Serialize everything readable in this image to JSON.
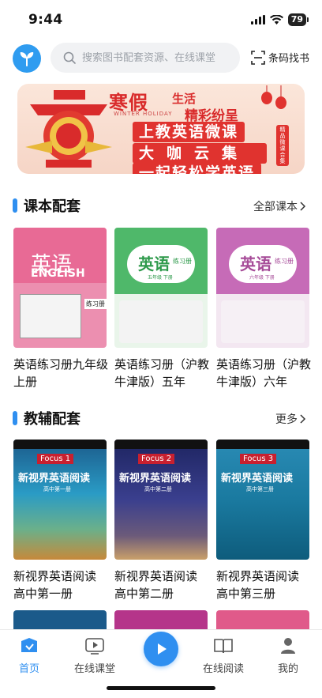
{
  "status": {
    "time": "9:44",
    "battery": "79"
  },
  "header": {
    "search_placeholder": "搜索图书配套资源、在线课堂",
    "scan_label": "条码找书"
  },
  "banner": {
    "title_main": "寒假",
    "title_small_1": "生活",
    "title_small_2": "精彩纷呈",
    "subtitle": "WINTER HOLIDAY",
    "line_1": "上教英语微课",
    "line_2": "大咖云集",
    "line_3": "一起轻松学英语",
    "tag": "精品微课合集"
  },
  "textbook_section": {
    "title": "课本配套",
    "more": "全部课本",
    "books": [
      {
        "title": "英语练习册九年级上册",
        "cover_main": "英语",
        "cover_sub": "ENGLISH",
        "cover_badge": "练习册",
        "color": "#e55b86"
      },
      {
        "title": "英语练习册（沪教牛津版）五年",
        "cover_main": "英语",
        "cover_sub": "练习册",
        "cover_grade": "五年级 下册",
        "color": "#4fb86a"
      },
      {
        "title": "英语练习册（沪教牛津版）六年",
        "cover_main": "英语",
        "cover_sub": "练习册",
        "cover_grade": "六年级 下册",
        "color": "#c66bb7"
      }
    ]
  },
  "tutorial_section": {
    "title": "教辅配套",
    "more": "更多",
    "books": [
      {
        "title": "新视界英语阅读 高中第一册",
        "focus": "Focus 1",
        "cover_main": "新视界英语阅读",
        "cover_grade": "高中第一册",
        "color": "#2c7fb8"
      },
      {
        "title": "新视界英语阅读 高中第二册",
        "focus": "Focus 2",
        "cover_main": "新视界英语阅读",
        "cover_grade": "高中第二册",
        "color": "#2b2f6e"
      },
      {
        "title": "新视界英语阅读 高中第三册",
        "focus": "Focus 3",
        "cover_main": "新视界英语阅读",
        "cover_grade": "高中第三册",
        "color": "#1f8fb0"
      }
    ]
  },
  "nav": {
    "home": "首页",
    "online_class": "在线课堂",
    "online_reading": "在线阅读",
    "mine": "我的"
  }
}
